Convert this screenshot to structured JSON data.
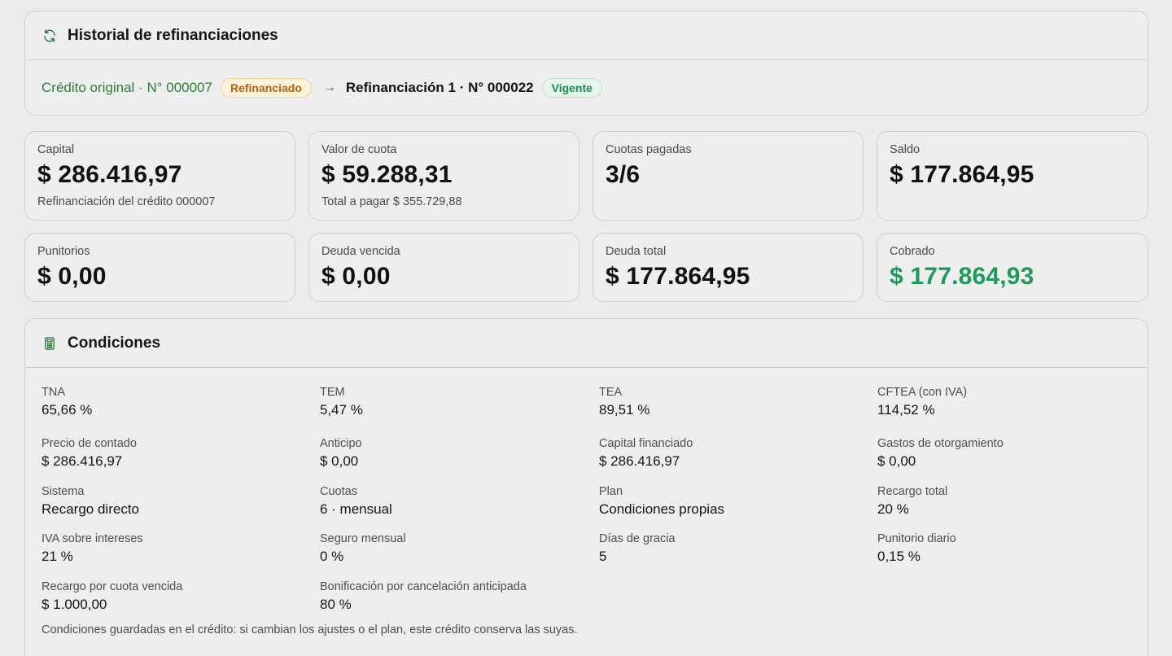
{
  "history": {
    "title": "Historial de refinanciaciones",
    "original_label": "Crédito original · N° 000007",
    "original_badge": "Refinanciado",
    "arrow": "→",
    "refi_label": "Refinanciación 1 · N° 000022",
    "refi_badge": "Vigente"
  },
  "stats": [
    {
      "label": "Capital",
      "value": "$ 286.416,97",
      "sub": "Refinanciación del crédito 000007"
    },
    {
      "label": "Valor de cuota",
      "value": "$ 59.288,31",
      "sub": "Total a pagar $ 355.729,88"
    },
    {
      "label": "Cuotas pagadas",
      "value": "3/6",
      "sub": ""
    },
    {
      "label": "Saldo",
      "value": "$ 177.864,95",
      "sub": ""
    },
    {
      "label": "Punitorios",
      "value": "$ 0,00"
    },
    {
      "label": "Deuda vencida",
      "value": "$ 0,00"
    },
    {
      "label": "Deuda total",
      "value": "$ 177.864,95"
    },
    {
      "label": "Cobrado",
      "value": "$ 177.864,93"
    }
  ],
  "conditions": {
    "title": "Condiciones",
    "items": [
      {
        "label": "TNA",
        "value": "65,66 %"
      },
      {
        "label": "TEM",
        "value": "5,47 %"
      },
      {
        "label": "TEA",
        "value": "89,51 %"
      },
      {
        "label": "CFTEA (con IVA)",
        "value": "114,52 %"
      },
      {
        "label": "Precio de contado",
        "value": "$ 286.416,97"
      },
      {
        "label": "Anticipo",
        "value": "$ 0,00"
      },
      {
        "label": "Capital financiado",
        "value": "$ 286.416,97"
      },
      {
        "label": "Gastos de otorgamiento",
        "value": "$ 0,00"
      },
      {
        "label": "Sistema",
        "value": "Recargo directo"
      },
      {
        "label": "Cuotas",
        "value": "6 · mensual"
      },
      {
        "label": "Plan",
        "value": "Condiciones propias"
      },
      {
        "label": "Recargo total",
        "value": "20 %"
      },
      {
        "label": "IVA sobre intereses",
        "value": "21 %"
      },
      {
        "label": "Seguro mensual",
        "value": "0 %"
      },
      {
        "label": "Días de gracia",
        "value": "5"
      },
      {
        "label": "Punitorio diario",
        "value": "0,15 %"
      },
      {
        "label": "Recargo por cuota vencida",
        "value": "$ 1.000,00"
      },
      {
        "label": "Bonificación por cancelación anticipada",
        "value": "80 %"
      }
    ],
    "note": "Condiciones guardadas en el crédito: si cambian los ajustes o el plan, este crédito conserva las suyas."
  },
  "colors": {
    "accent_green": "#2f7a3d",
    "collected_green": "#1f9a5a",
    "refinanced_badge": "#b0630c",
    "active_badge": "#1c8a4d"
  },
  "icons": {
    "history": "refresh-icon",
    "conditions": "calculator-icon"
  }
}
